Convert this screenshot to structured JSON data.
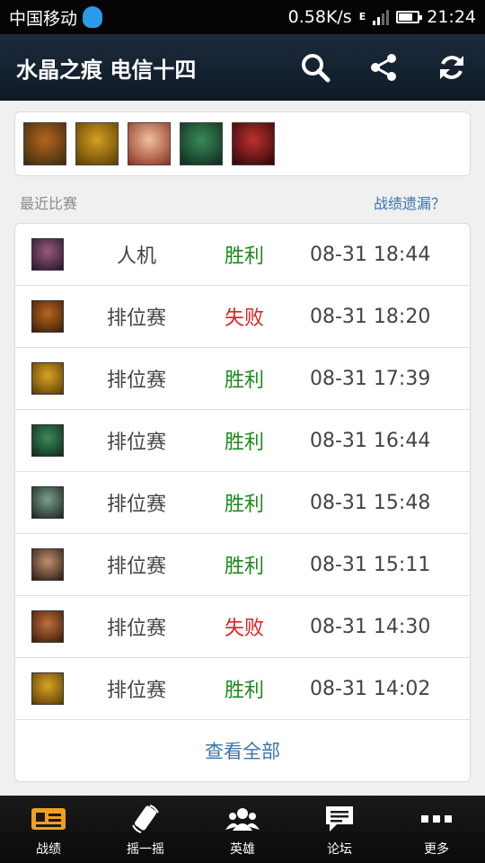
{
  "status_bar": {
    "carrier": "中国移动",
    "speed": "0.58K/s",
    "net_type": "E",
    "time": "21:24",
    "battery_level": 0.75
  },
  "app_bar": {
    "title": "水晶之痕 电信十四",
    "actions": [
      "search-icon",
      "share-icon",
      "refresh-icon"
    ]
  },
  "recent_champions": [
    {
      "color_a": "#b5651d",
      "color_b": "#3a2a10"
    },
    {
      "color_a": "#d4a020",
      "color_b": "#5a3c05"
    },
    {
      "color_a": "#f0c0a0",
      "color_b": "#8a3020"
    },
    {
      "color_a": "#3a8a5a",
      "color_b": "#0e2a1c"
    },
    {
      "color_a": "#c03030",
      "color_b": "#2a0808"
    }
  ],
  "section": {
    "label": "最近比赛",
    "link": "战绩遗漏？"
  },
  "matches": [
    {
      "mode": "人机",
      "result": "胜利",
      "win": true,
      "time": "08-31 18:44",
      "color_a": "#9a5a7a",
      "color_b": "#241530"
    },
    {
      "mode": "排位赛",
      "result": "失败",
      "win": false,
      "time": "08-31 18:20",
      "color_a": "#b8681e",
      "color_b": "#3a1c08"
    },
    {
      "mode": "排位赛",
      "result": "胜利",
      "win": true,
      "time": "08-31 17:39",
      "color_a": "#d8a424",
      "color_b": "#5a3c05"
    },
    {
      "mode": "排位赛",
      "result": "胜利",
      "win": true,
      "time": "08-31 16:44",
      "color_a": "#3a8a5a",
      "color_b": "#0e2a1c"
    },
    {
      "mode": "排位赛",
      "result": "胜利",
      "win": true,
      "time": "08-31 15:48",
      "color_a": "#7aa08a",
      "color_b": "#1a2420"
    },
    {
      "mode": "排位赛",
      "result": "胜利",
      "win": true,
      "time": "08-31 15:11",
      "color_a": "#c09070",
      "color_b": "#2a1a10"
    },
    {
      "mode": "排位赛",
      "result": "失败",
      "win": false,
      "time": "08-31 14:30",
      "color_a": "#c0703a",
      "color_b": "#3a1a0a"
    },
    {
      "mode": "排位赛",
      "result": "胜利",
      "win": true,
      "time": "08-31 14:02",
      "color_a": "#d8a424",
      "color_b": "#5a3c05"
    }
  ],
  "view_all": "查看全部",
  "tabs": [
    {
      "label": "战绩",
      "icon": "record-card-icon",
      "active": true
    },
    {
      "label": "摇一摇",
      "icon": "shake-phone-icon",
      "active": false
    },
    {
      "label": "英雄",
      "icon": "heroes-icon",
      "active": false
    },
    {
      "label": "论坛",
      "icon": "forum-chat-icon",
      "active": false
    },
    {
      "label": "更多",
      "icon": "more-dots-icon",
      "active": false
    }
  ],
  "colors": {
    "win": "#1a8a1a",
    "loss": "#e02020",
    "link": "#3a75a8",
    "active_tab_icon": "#f0a020"
  }
}
